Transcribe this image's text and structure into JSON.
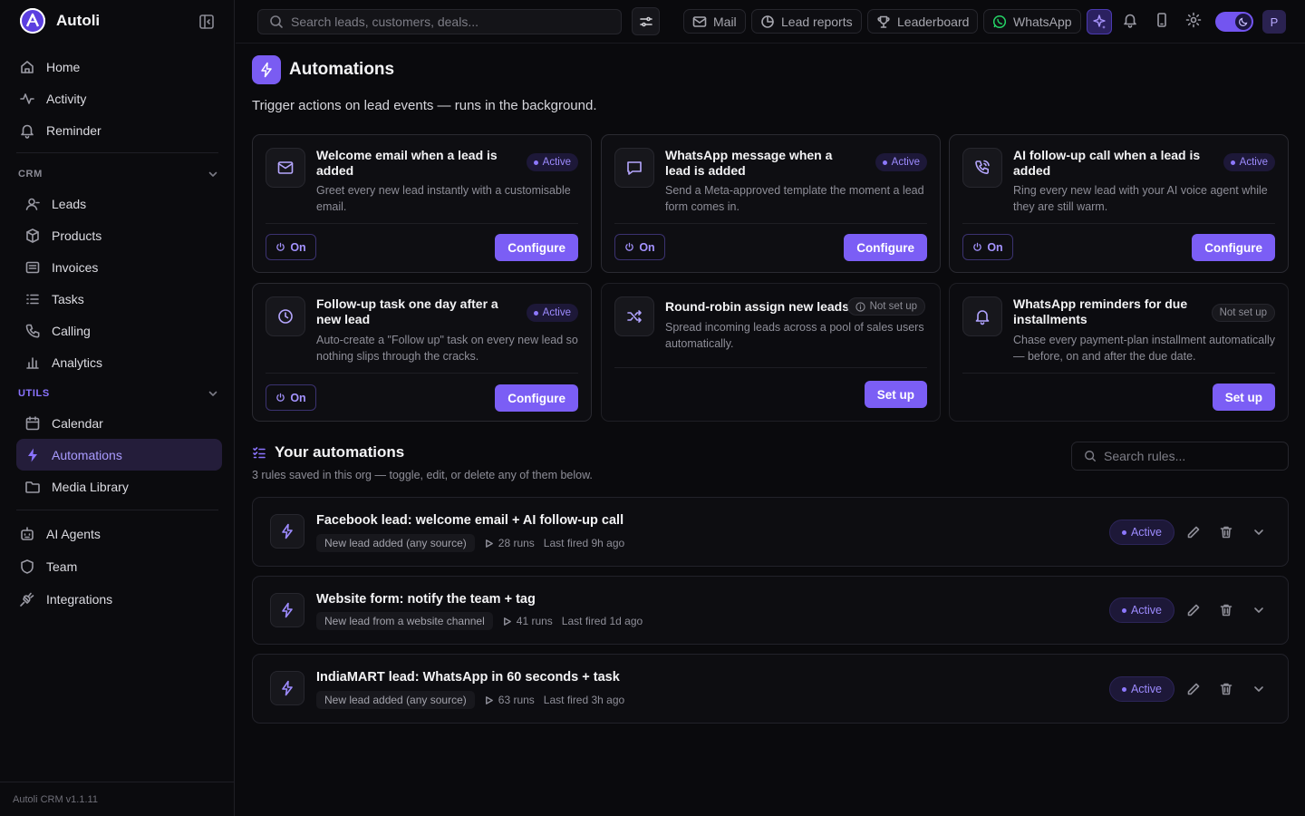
{
  "sidebar": {
    "brand": "Autoli",
    "top_items": [
      {
        "label": "Home",
        "icon": "home-icon"
      },
      {
        "label": "Activity",
        "icon": "activity-icon"
      },
      {
        "label": "Reminder",
        "icon": "bell-icon"
      }
    ],
    "crm_section": {
      "label": "CRM",
      "items": [
        {
          "label": "Leads",
          "icon": "user-icon"
        },
        {
          "label": "Products",
          "icon": "box-icon"
        },
        {
          "label": "Invoices",
          "icon": "invoice-icon"
        },
        {
          "label": "Tasks",
          "icon": "list-icon"
        },
        {
          "label": "Calling",
          "icon": "phone-icon"
        },
        {
          "label": "Analytics",
          "icon": "bar-chart-icon"
        }
      ]
    },
    "utils_section": {
      "label": "UTILS",
      "items": [
        {
          "label": "Calendar",
          "icon": "calendar-icon"
        },
        {
          "label": "Automations",
          "icon": "bolt-icon",
          "active": true
        },
        {
          "label": "Media Library",
          "icon": "folder-icon"
        }
      ]
    },
    "bottom_items": [
      {
        "label": "AI Agents",
        "icon": "bot-icon"
      },
      {
        "label": "Team",
        "icon": "shield-icon"
      },
      {
        "label": "Integrations",
        "icon": "plug-icon"
      }
    ],
    "footer": "Autoli CRM v1.1.11"
  },
  "topbar": {
    "search_placeholder": "Search leads, customers, deals...",
    "pills": [
      {
        "label": "Mail",
        "icon": "mail-icon"
      },
      {
        "label": "Lead reports",
        "icon": "pie-chart-icon"
      },
      {
        "label": "Leaderboard",
        "icon": "trophy-icon"
      },
      {
        "label": "WhatsApp",
        "icon": "whatsapp-icon"
      }
    ],
    "avatar_initial": "P"
  },
  "page": {
    "title": "Automations",
    "subtitle": "Trigger actions on lead events — runs in the background."
  },
  "templates": [
    {
      "title": "Welcome email when a lead is added",
      "desc": "Greet every new lead instantly with a customisable email.",
      "status": "Active",
      "toggle": "On",
      "action": "Configure",
      "icon": "mail-icon"
    },
    {
      "title": "WhatsApp message when a lead is added",
      "desc": "Send a Meta-approved template the moment a lead form comes in.",
      "status": "Active",
      "toggle": "On",
      "action": "Configure",
      "icon": "message-icon"
    },
    {
      "title": "AI follow-up call when a lead is added",
      "desc": "Ring every new lead with your AI voice agent while they are still warm.",
      "status": "Active",
      "toggle": "On",
      "action": "Configure",
      "icon": "phone-call-icon"
    },
    {
      "title": "Follow-up task one day after a new lead",
      "desc": "Auto-create a \"Follow up\" task on every new lead so nothing slips through the cracks.",
      "status": "Active",
      "toggle": "On",
      "action": "Configure",
      "icon": "clock-icon"
    },
    {
      "title": "Round-robin assign new leads",
      "desc": "Spread incoming leads across a pool of sales users automatically.",
      "status": "Not set up",
      "action": "Set up",
      "icon": "shuffle-icon"
    },
    {
      "title": "WhatsApp reminders for due installments",
      "desc": "Chase every payment-plan installment automatically — before, on and after the due date.",
      "status": "Not set up",
      "action": "Set up",
      "icon": "bell-icon"
    }
  ],
  "your_automations": {
    "title": "Your automations",
    "subtitle": "3 rules saved in this org — toggle, edit, or delete any of them below.",
    "search_placeholder": "Search rules...",
    "rules": [
      {
        "name": "Facebook lead: welcome email + AI follow-up call",
        "trigger": "New lead added (any source)",
        "runs": "28 runs",
        "last": "Last fired 9h ago",
        "status": "Active"
      },
      {
        "name": "Website form: notify the team + tag",
        "trigger": "New lead from a website channel",
        "runs": "41 runs",
        "last": "Last fired 1d ago",
        "status": "Active"
      },
      {
        "name": "IndiaMART lead: WhatsApp in 60 seconds + task",
        "trigger": "New lead added (any source)",
        "runs": "63 runs",
        "last": "Last fired 3h ago",
        "status": "Active"
      }
    ]
  },
  "colors": {
    "accent": "#7b5ef5",
    "background": "#0a0a0d",
    "active_badge": "#9d8bff"
  }
}
